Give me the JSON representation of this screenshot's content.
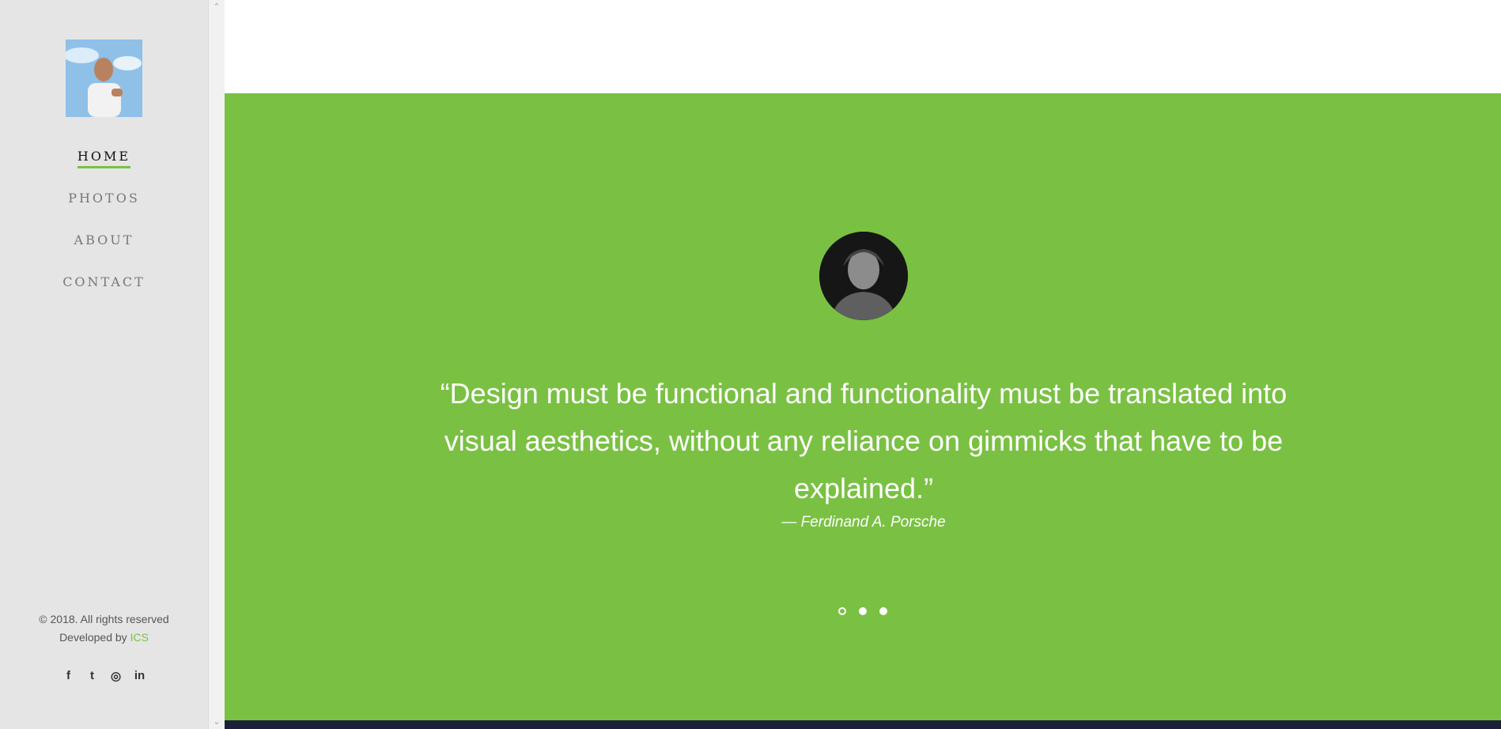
{
  "sidebar": {
    "avatar_icon": "profile-photo",
    "nav": [
      {
        "label": "HOME",
        "active": true
      },
      {
        "label": "PHOTOS",
        "active": false
      },
      {
        "label": "ABOUT",
        "active": false
      },
      {
        "label": "CONTACT",
        "active": false
      }
    ],
    "footer": {
      "copyright": "© 2018. All rights reserved",
      "developed_prefix": "Developed by ",
      "developer": "ICS"
    },
    "social": [
      {
        "icon": "facebook-icon",
        "glyph": "f"
      },
      {
        "icon": "twitter-icon",
        "glyph": "t"
      },
      {
        "icon": "instagram-icon",
        "glyph": "◎"
      },
      {
        "icon": "linkedin-icon",
        "glyph": "in"
      }
    ]
  },
  "hero": {
    "quote": "“Design must be functional and functionality must be translated into visual aesthetics, without any reliance on gimmicks that have to be explained.”",
    "author": "— Ferdinand A. Porsche",
    "slides": [
      true,
      false,
      false
    ]
  },
  "colors": {
    "accent": "#7ac143",
    "sidebar_bg": "#e5e5e5"
  }
}
